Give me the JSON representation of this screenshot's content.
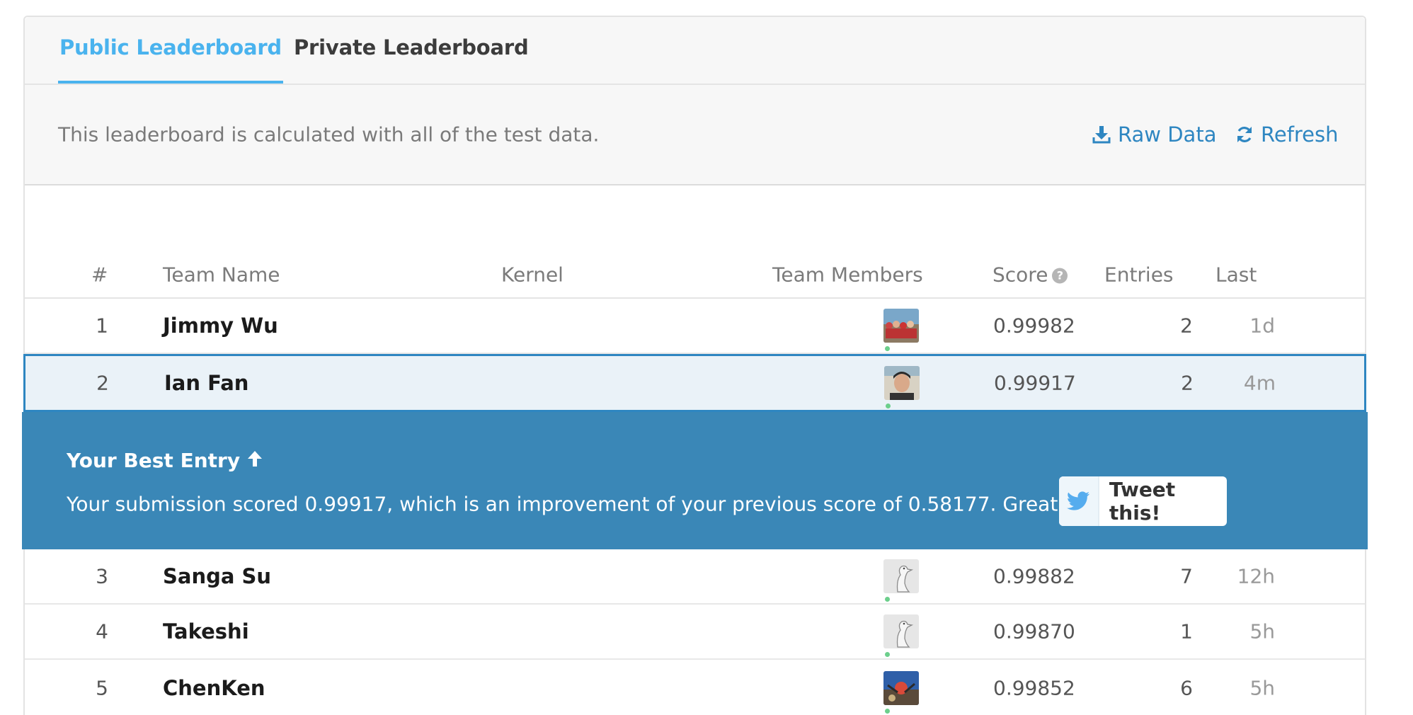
{
  "tabs": [
    {
      "label": "Public Leaderboard",
      "active": true
    },
    {
      "label": "Private Leaderboard",
      "active": false
    }
  ],
  "info": {
    "text": "This leaderboard is calculated with all of the test data.",
    "raw_data_label": "Raw Data",
    "refresh_label": "Refresh"
  },
  "columns": {
    "rank": "#",
    "team_name": "Team Name",
    "kernel": "Kernel",
    "team_members": "Team Members",
    "score": "Score",
    "entries": "Entries",
    "last": "Last"
  },
  "rows": [
    {
      "rank": "1",
      "team": "Jimmy Wu",
      "score": "0.99982",
      "entries": "2",
      "last": "1d",
      "avatar": "group-photo"
    },
    {
      "rank": "2",
      "team": "Ian Fan",
      "score": "0.99917",
      "entries": "2",
      "last": "4m",
      "avatar": "person-photo"
    },
    {
      "rank": "3",
      "team": "Sanga Su",
      "score": "0.99882",
      "entries": "7",
      "last": "12h",
      "avatar": "goose-default"
    },
    {
      "rank": "4",
      "team": "Takeshi",
      "score": "0.99870",
      "entries": "1",
      "last": "5h",
      "avatar": "goose-default"
    },
    {
      "rank": "5",
      "team": "ChenKen",
      "score": "0.99852",
      "entries": "6",
      "last": "5h",
      "avatar": "outdoor-photo"
    }
  ],
  "best_entry": {
    "title": "Your Best Entry",
    "message": "Your submission scored 0.99917, which is an improvement of your previous score of 0.58177. Great job!",
    "tweet_label": "Tweet this!"
  },
  "colors": {
    "accent": "#4ab3ee",
    "link": "#2e86c1",
    "banner": "#3a87b7",
    "highlight_row": "#eaf2f8"
  }
}
